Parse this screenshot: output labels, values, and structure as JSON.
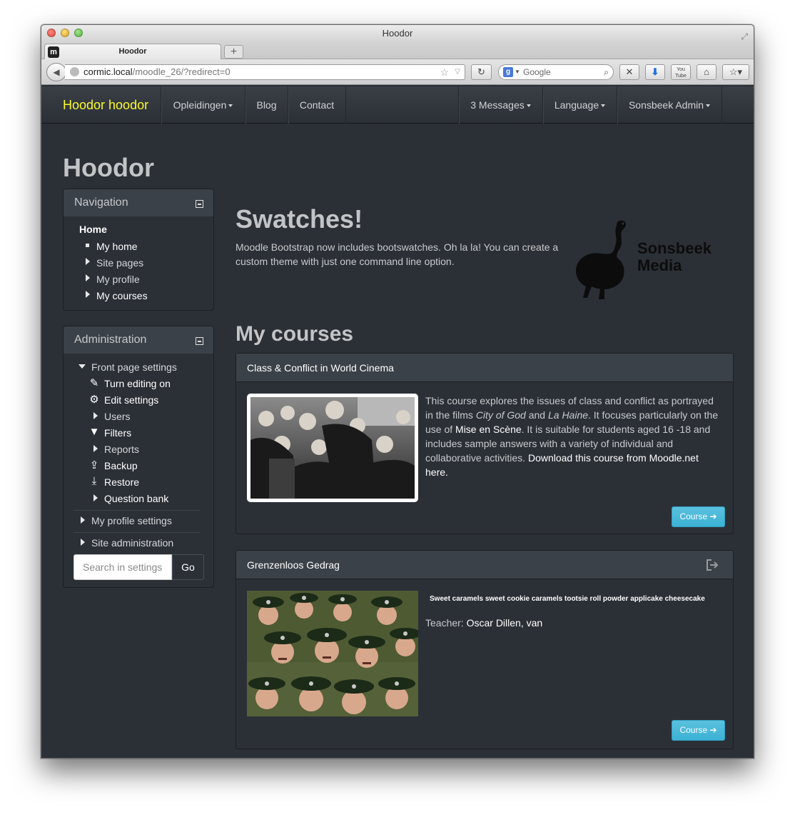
{
  "browser": {
    "window_title": "Hoodor",
    "tab_title": "Hoodor",
    "tab_favicon": "m",
    "url_host": "cormic.local",
    "url_path": "/moodle_26/?redirect=0",
    "search_placeholder": "Google",
    "search_engine_badge": "g",
    "youtube_badge": "You Tube"
  },
  "navbar": {
    "brand": "Hoodor hoodor",
    "items": [
      {
        "label": "Opleidingen"
      },
      {
        "label": "Blog"
      },
      {
        "label": "Contact"
      }
    ],
    "right_items": [
      {
        "label": "3 Messages"
      },
      {
        "label": "Language"
      },
      {
        "label": "Sonsbeek Admin"
      }
    ]
  },
  "page": {
    "title": "Hoodor"
  },
  "navigation_block": {
    "title": "Navigation",
    "home": "Home",
    "items": [
      "My home",
      "Site pages",
      "My profile",
      "My courses"
    ]
  },
  "admin_block": {
    "title": "Administration",
    "front_page_settings": "Front page settings",
    "front_items": [
      "Turn editing on",
      "Edit settings",
      "Users",
      "Filters",
      "Reports",
      "Backup",
      "Restore",
      "Question bank"
    ],
    "my_profile_settings": "My profile settings",
    "site_administration": "Site administration",
    "search_placeholder": "Search in settings",
    "go_label": "Go"
  },
  "swatches": {
    "title": "Swatches!",
    "text": "Moodle Bootstrap now includes bootswatches. Oh la la! You can create a custom theme with just one command line option.",
    "logo_line1": "Sonsbeek",
    "logo_line2": "Media"
  },
  "my_courses": {
    "title": "My courses",
    "courses": [
      {
        "title": "Class & Conflict in World Cinema",
        "desc_1": "This course explores the issues of class and conflict as portrayed in the films ",
        "film_1": "City of God",
        "desc_2": " and ",
        "film_2": "La Haine",
        "desc_3": ". It focuses particularly on the use of ",
        "link_1": "Mise en Scène",
        "desc_4": ".  It is suitable for students aged 16 -18 and includes sample answers with a variety of individual and collaborative activities. ",
        "link_2": "Download this course from Moodle.net here",
        "desc_5": ".",
        "button": "Course ➔"
      },
      {
        "title": "Grenzenloos Gedrag",
        "summary": "Sweet caramels sweet cookie caramels tootsie roll powder applicake cheesecake",
        "teacher_label": "Teacher: ",
        "teacher_name": "Oscar Dillen, van",
        "button": "Course ➔"
      }
    ]
  },
  "colors": {
    "brand": "#fbfb2a",
    "background": "#2b3037",
    "info_button": "#5bc0de"
  }
}
